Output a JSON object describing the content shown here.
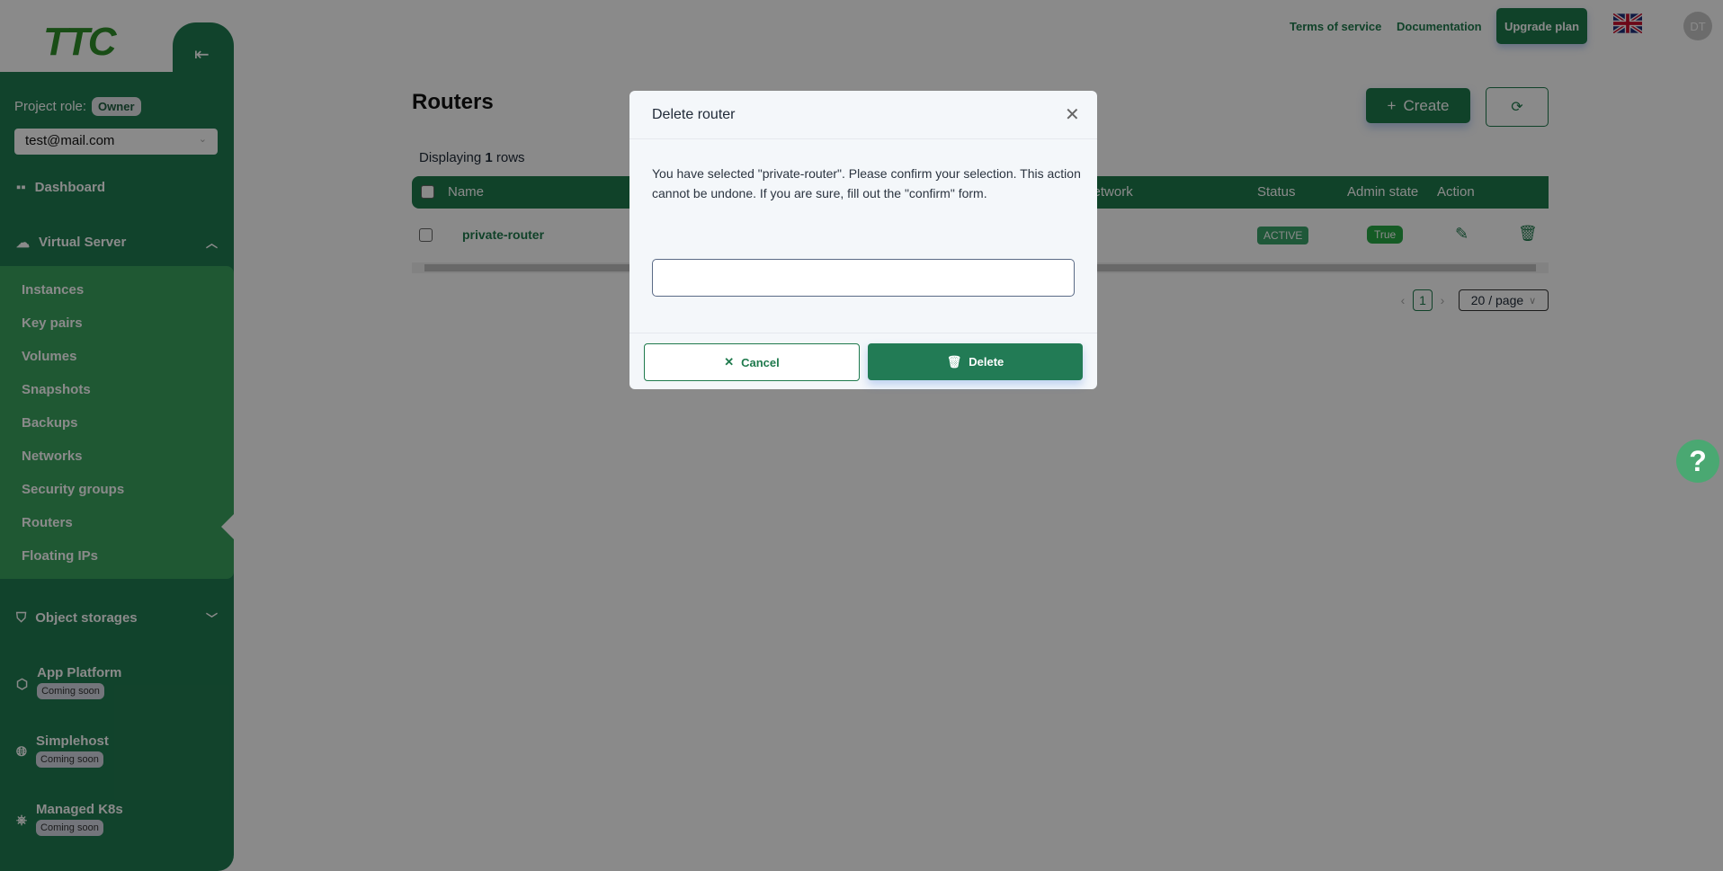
{
  "header": {
    "terms": "Terms of service",
    "docs": "Documentation",
    "upgrade": "Upgrade plan",
    "avatar": "DT",
    "language_icon": "uk-flag-icon"
  },
  "sidebar": {
    "logo": "TTC",
    "project_role_label": "Project role:",
    "project_role": "Owner",
    "account": "test@mail.com",
    "dashboard": "Dashboard",
    "virtual_server": "Virtual Server",
    "sub_items": [
      "Instances",
      "Key pairs",
      "Volumes",
      "Snapshots",
      "Backups",
      "Networks",
      "Security groups",
      "Routers",
      "Floating IPs"
    ],
    "object_storages": "Object storages",
    "app_platform": "App Platform",
    "simplehost": "Simplehost",
    "managed_k8s": "Managed K8s",
    "coming_soon": "Coming soon"
  },
  "main": {
    "title": "Routers",
    "create": "Create",
    "displaying_prefix": "Displaying",
    "row_count": "1",
    "displaying_suffix": "rows",
    "columns": {
      "name": "Name",
      "external_network": "External network",
      "status": "Status",
      "admin_state": "Admin state",
      "action": "Action"
    },
    "rows": [
      {
        "name": "private-router",
        "status": "ACTIVE",
        "admin_state": "True"
      }
    ],
    "pagination": {
      "page": "1",
      "page_size": "20 / page"
    }
  },
  "modal": {
    "title": "Delete router",
    "message": "You have selected \"private-router\". Please confirm your selection. This action cannot be undone. If you are sure, fill out the \"confirm\" form.",
    "input_value": "",
    "cancel": "Cancel",
    "delete": "Delete"
  },
  "help": "?",
  "colors": {
    "brand": "#1f7a4d",
    "submenu": "#3aa35f",
    "overlay": "rgba(0,0,0,0.46)"
  }
}
